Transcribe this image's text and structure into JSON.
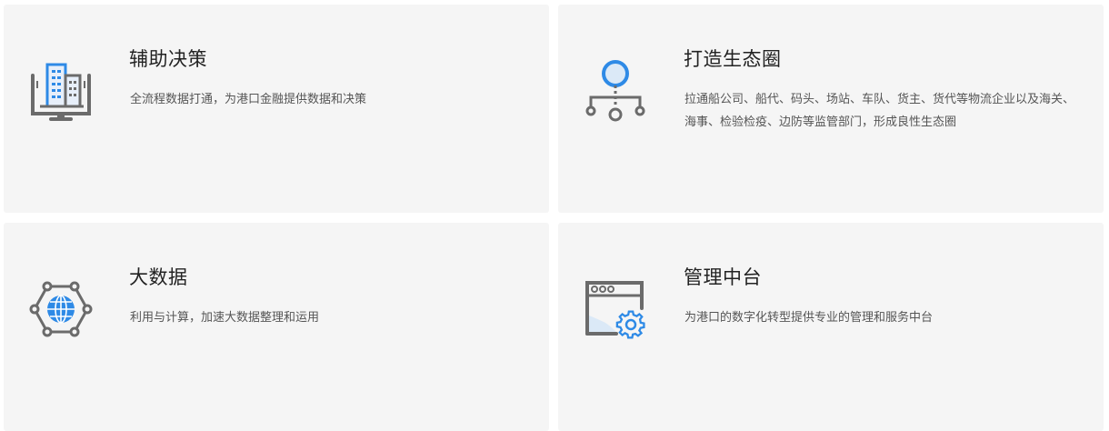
{
  "cards": [
    {
      "title": "辅助决策",
      "description": "全流程数据打通，为港口金融提供数据和决策",
      "icon": "building-monitor-icon"
    },
    {
      "title": "打造生态圈",
      "description": "拉通船公司、船代、码头、场站、车队、货主、货代等物流企业以及海关、海事、检验检疫、边防等监管部门，形成良性生态圈",
      "icon": "network-node-icon"
    },
    {
      "title": "大数据",
      "description": "利用与计算，加速大数据整理和运用",
      "icon": "globe-network-icon"
    },
    {
      "title": "管理中台",
      "description": "为港口的数字化转型提供专业的管理和服务中台",
      "icon": "browser-gear-icon"
    }
  ],
  "colors": {
    "card_bg": "#f5f5f5",
    "icon_gray": "#6b6b6b",
    "icon_blue": "#2e8ae6",
    "icon_light_blue": "#dbe9f7"
  }
}
